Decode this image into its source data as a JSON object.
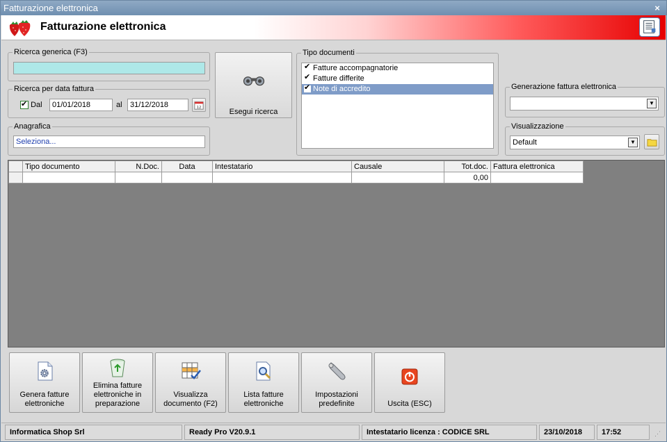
{
  "window": {
    "title": "Fatturazione elettronica",
    "close_glyph": "×"
  },
  "banner": {
    "title": "Fatturazione elettronica",
    "logo_icon": "strawberry-icon",
    "menu_icon": "list-icon"
  },
  "search": {
    "generic_label": "Ricerca generica (F3)",
    "generic_value": "",
    "date_label": "Ricerca per data fattura",
    "dal_checked": true,
    "dal_label": "Dal",
    "date_from": "01/01/2018",
    "al_label": "al",
    "date_to": "31/12/2018",
    "anagrafica_label": "Anagrafica",
    "anagrafica_value": "Seleziona..."
  },
  "search_button": {
    "label": "Esegui ricerca",
    "icon": "binoculars-icon"
  },
  "doc_types": {
    "label": "Tipo documenti",
    "items": [
      {
        "label": "Fatture accompagnatorie",
        "checked": true,
        "selected": false
      },
      {
        "label": "Fatture differite",
        "checked": true,
        "selected": false
      },
      {
        "label": "Note di accredito",
        "checked": true,
        "selected": true
      }
    ]
  },
  "generation": {
    "label": "Generazione fattura elettronica",
    "value": ""
  },
  "view": {
    "label": "Visualizzazione",
    "value": "Default"
  },
  "grid": {
    "columns": [
      "Tipo documento",
      "N.Doc.",
      "Data",
      "Intestatario",
      "Causale",
      "Tot.doc.",
      "Fattura elettronica"
    ],
    "rows": [
      [
        "",
        "",
        "",
        "",
        "",
        "0,00",
        ""
      ]
    ]
  },
  "toolbar": {
    "buttons": [
      {
        "name": "genera-fatture-button",
        "label": "Genera fatture elettroniche",
        "icon": "gear-document-icon"
      },
      {
        "name": "elimina-fatture-button",
        "label": "Elimina fatture elettroniche in preparazione",
        "icon": "recycle-bin-icon"
      },
      {
        "name": "visualizza-documento-button",
        "label": "Visualizza documento (F2)",
        "icon": "table-check-icon"
      },
      {
        "name": "lista-fatture-button",
        "label": "Lista fatture elettroniche",
        "icon": "document-search-icon"
      },
      {
        "name": "impostazioni-button",
        "label": "Impostazioni predefinite",
        "icon": "wrench-icon"
      },
      {
        "name": "uscita-button",
        "label": "Uscita (ESC)",
        "icon": "power-icon"
      }
    ]
  },
  "status": {
    "company": "Informatica Shop Srl",
    "version": "Ready Pro V20.9.1",
    "license": "Intestatario licenza : CODICE SRL",
    "date": "23/10/2018",
    "time": "17:52"
  },
  "colors": {
    "search_field_bg": "#aee8e8",
    "selected_item_bg": "#7f9cc8",
    "banner_red": "#e60000",
    "grid_bg": "#808080"
  }
}
